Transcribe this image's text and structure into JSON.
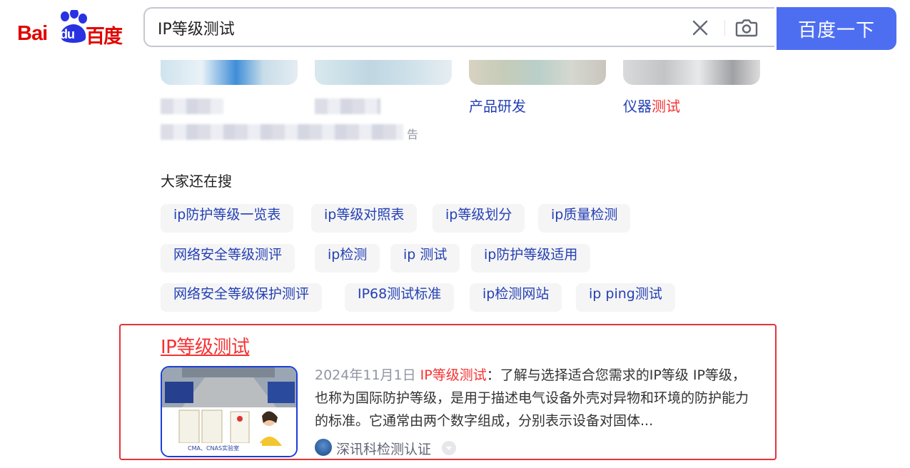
{
  "brand": {
    "logo_bai": "Bai",
    "logo_du": "du",
    "logo_cn": "百度",
    "color": "#e10601",
    "accent": "#4e6ef2"
  },
  "search": {
    "query": "IP等级测试",
    "button_label": "百度一下",
    "clear_icon": "close-icon",
    "camera_icon": "camera-icon"
  },
  "image_cards": [
    {
      "label": ""
    },
    {
      "label": ""
    },
    {
      "label": "产品研发"
    },
    {
      "label_prefix": "仪器",
      "label_highlight": "测试"
    }
  ],
  "ad": {
    "mark": "告"
  },
  "related": {
    "title": "大家还在搜",
    "items": [
      "ip防护等级一览表",
      "ip等级对照表",
      "ip等级划分",
      "ip质量检测",
      "网络安全等级测评",
      "ip检测",
      "ip 测试",
      "ip防护等级适用",
      "网络安全等级保护测评",
      "IP68测试标准",
      "ip检测网站",
      "ip ping测试"
    ]
  },
  "result": {
    "title": "IP等级测试",
    "date": "2024年11月1日",
    "highlight": "IP等级测试",
    "snippet_1": "：了解与选择适合您需求的IP等级 IP等级，",
    "snippet_2": "也称为国际防护等级，是用于描述电气设备外壳对异物和环境的防护能力",
    "snippet_3": "的标准。它通常由两个数字组成，分别表示设备对固体...",
    "source": "深讯科检测认证",
    "thumb_caption": "CMA、CNAS实验室",
    "highlight_color": "#f73131"
  }
}
